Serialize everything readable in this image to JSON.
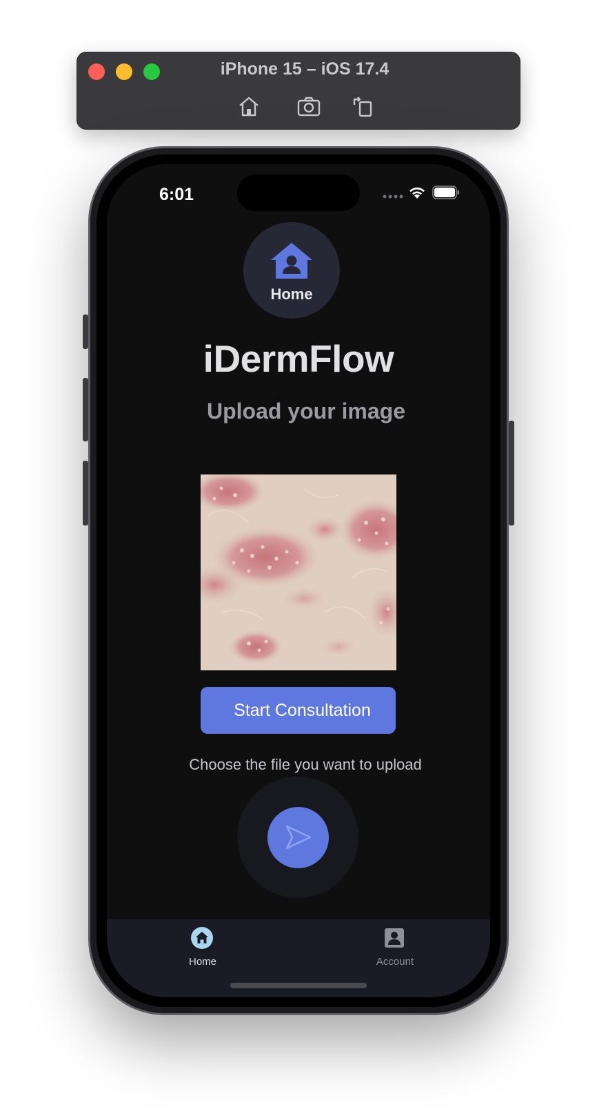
{
  "simulator": {
    "title": "iPhone 15 – iOS 17.4",
    "tools": [
      "home-icon",
      "screenshot-icon",
      "rotate-icon"
    ]
  },
  "status_bar": {
    "time": "6:01"
  },
  "header_badge": {
    "icon": "house-user-icon",
    "label": "Home"
  },
  "main": {
    "title": "iDermFlow",
    "subtitle": "Upload your image",
    "start_button_label": "Start Consultation",
    "choose_file_text": "Choose the file you want to upload",
    "upload_icon": "send-icon"
  },
  "tab_bar": {
    "items": [
      {
        "label": "Home",
        "icon": "home-icon",
        "active": true
      },
      {
        "label": "Account",
        "icon": "account-box-icon",
        "active": false
      }
    ]
  },
  "colors": {
    "accent": "#5f78e0",
    "screen_background": "#0f0f10",
    "tab_bar_background": "#1b1b25",
    "active_tab_icon": "#a9d6ef"
  }
}
